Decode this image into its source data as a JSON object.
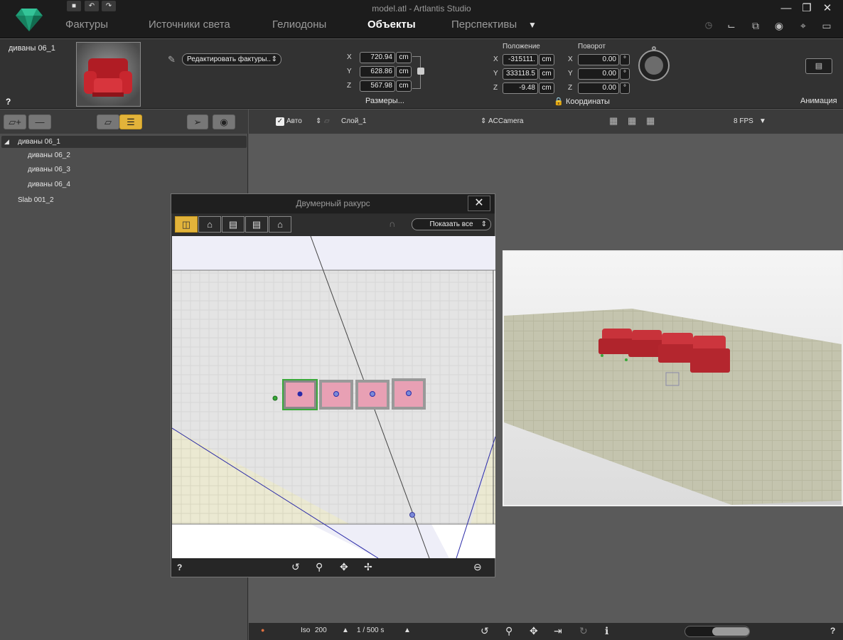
{
  "app": {
    "title": "model.atl - Artlantis Studio"
  },
  "tabs": [
    {
      "label": "Фактуры"
    },
    {
      "label": "Источники света"
    },
    {
      "label": "Гелиодоны"
    },
    {
      "label": "Объекты"
    },
    {
      "label": "Перспективы"
    }
  ],
  "active_tab": "Объекты",
  "object": {
    "name": "диваны 06_1",
    "edit_textures_label": "Редактировать фактуры..",
    "help": "?",
    "dimensions": {
      "label": "Размеры...",
      "x": "720.94",
      "y": "628.86",
      "z": "567.98",
      "unit": "cm"
    },
    "position": {
      "label": "Положение",
      "x": "-315111.",
      "y": "333118.5",
      "z": "-9.48",
      "unit": "cm"
    },
    "rotation": {
      "label": "Поворот",
      "x": "0.00",
      "y": "0.00",
      "z": "0.00",
      "unit": "°"
    },
    "coordinates_label": "Координаты",
    "animation_label": "Анимация",
    "axis_x": "X",
    "axis_y": "Y",
    "axis_z": "Z"
  },
  "tree": [
    {
      "label": "диваны 06_1",
      "indent": 0,
      "expanded": true,
      "selected": true
    },
    {
      "label": "диваны 06_2",
      "indent": 1
    },
    {
      "label": "диваны 06_3",
      "indent": 1
    },
    {
      "label": "диваны 06_4",
      "indent": 1
    },
    {
      "label": "Slab 001_2",
      "indent": 0
    }
  ],
  "viewport_toolbar": {
    "auto_label": "Авто",
    "auto_checked": true,
    "layer": "Слой_1",
    "camera": "ACCamera",
    "fps": "8 FPS"
  },
  "view2d": {
    "title": "Двумерный ракурс",
    "show_all_label": "Показать все",
    "help": "?"
  },
  "bottombar": {
    "iso_label": "Iso",
    "iso_value": "200",
    "shutter": "1 / 500 s",
    "help": "?"
  },
  "colors": {
    "accent": "#e2b33a",
    "sofa_red": "#c8323a",
    "plan_sofa": "#e8a0b4",
    "selection_green": "#3aa83a",
    "camera_line": "#2a2aa8"
  }
}
